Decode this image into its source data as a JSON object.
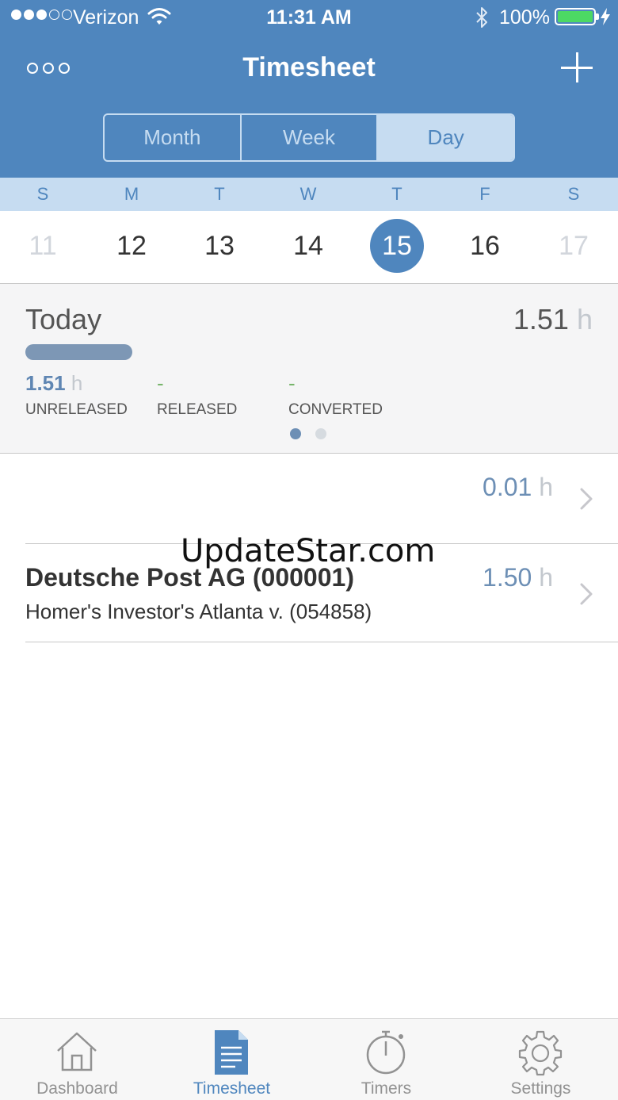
{
  "status_bar": {
    "carrier": "Verizon",
    "time": "11:31 AM",
    "battery": "100%"
  },
  "nav": {
    "title": "Timesheet"
  },
  "segments": [
    {
      "label": "Month",
      "active": false
    },
    {
      "label": "Week",
      "active": false
    },
    {
      "label": "Day",
      "active": true
    }
  ],
  "week": {
    "days": [
      "S",
      "M",
      "T",
      "W",
      "T",
      "F",
      "S"
    ],
    "dates": [
      "11",
      "12",
      "13",
      "14",
      "15",
      "16",
      "17"
    ],
    "selected_index": 4
  },
  "summary": {
    "label": "Today",
    "total": "1.51",
    "unit": "h",
    "progress": 1.0,
    "stats": [
      {
        "value": "1.51",
        "unit": "h",
        "label": "UNRELEASED"
      },
      {
        "value": "-",
        "label": "RELEASED"
      },
      {
        "value": "-",
        "label": "CONVERTED"
      }
    ],
    "page": 1,
    "pages": 2
  },
  "entries": [
    {
      "client": "",
      "matter": "",
      "hours": "0.01",
      "unit": "h"
    },
    {
      "client": "Deutsche Post AG (000001)",
      "matter": "Homer's Investor's Atlanta v. (054858)",
      "hours": "1.50",
      "unit": "h"
    }
  ],
  "watermark": "UpdateStar.com",
  "tabs": [
    {
      "label": "Dashboard",
      "icon": "house-icon",
      "active": false
    },
    {
      "label": "Timesheet",
      "icon": "document-icon",
      "active": true
    },
    {
      "label": "Timers",
      "icon": "stopwatch-icon",
      "active": false
    },
    {
      "label": "Settings",
      "icon": "gear-icon",
      "active": false
    }
  ],
  "colors": {
    "header": "#4f86be",
    "accent_light": "#c6dcf1",
    "selected_day": "#4f86be",
    "hours_text": "#6d8fb5",
    "released_dash": "#77b56b",
    "battery": "#4cd964"
  }
}
